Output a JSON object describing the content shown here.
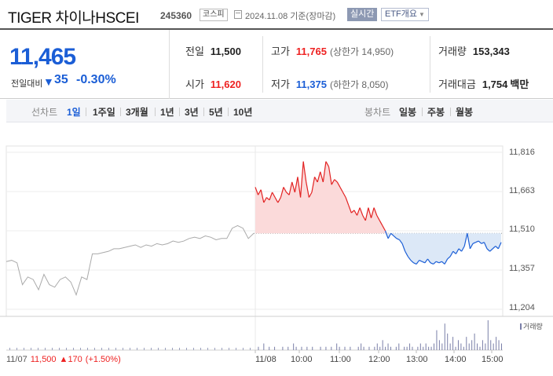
{
  "header": {
    "name": "TIGER 차이나HSCEI",
    "code": "245360",
    "market": "코스피",
    "date_text": "2024.11.08 기준(장마감)",
    "realtime": "실시간",
    "etf_overview": "ETF개요"
  },
  "quote": {
    "price": "11,465",
    "compare_label": "전일대비",
    "change_arrow": "▼",
    "change": "35",
    "change_pct": "-0.30%",
    "prev_label": "전일",
    "prev": "11,500",
    "open_label": "시가",
    "open": "11,620",
    "high_label": "고가",
    "high": "11,765",
    "upper_limit": "(상한가 14,950)",
    "low_label": "저가",
    "low": "11,375",
    "lower_limit": "(하한가 8,050)",
    "volume_label": "거래량",
    "volume": "153,343",
    "amount_label": "거래대금",
    "amount": "1,754",
    "amount_unit": "백만"
  },
  "period_bar": {
    "chart_label": "선차트",
    "periods": [
      "1일",
      "1주일",
      "3개월",
      "1년",
      "3년",
      "5년",
      "10년"
    ],
    "selected": "1일",
    "candle_label": "봉차트",
    "candles": [
      "일봉",
      "주봉",
      "월봉"
    ]
  },
  "colors": {
    "up": "#e22222",
    "down": "#1b5ed6",
    "up_fill": "#fbdada",
    "down_fill": "#dce8f7",
    "prev_line": "#999999"
  },
  "chart_data": {
    "type": "line",
    "ylim": [
      11204,
      11816
    ],
    "yticks": [
      "11,816",
      "11,663",
      "11,510",
      "11,357",
      "11,204"
    ],
    "xticks": [
      "11/07",
      "11/08",
      "10:00",
      "11:00",
      "12:00",
      "13:00",
      "14:00",
      "15:00"
    ],
    "baseline": 11500,
    "series": [
      {
        "values": [
          11390,
          11395,
          11385,
          11300,
          11330,
          11320,
          11280,
          11340,
          11300,
          11290,
          11320,
          11330,
          11310,
          11260,
          11330,
          11320,
          11420,
          11420,
          11425,
          11430,
          11440,
          11440,
          11445,
          11450,
          11455,
          11445,
          11455,
          11450,
          11460,
          11455,
          11460,
          11470,
          11465,
          11470,
          11480,
          11485,
          11480,
          11490,
          11485,
          11475,
          11480,
          11480,
          11520,
          11530,
          11520,
          11480,
          11500
        ]
      },
      {
        "values": [
          11680,
          11650,
          11670,
          11620,
          11640,
          11630,
          11660,
          11640,
          11620,
          11640,
          11680,
          11660,
          11650,
          11700,
          11660,
          11720,
          11640,
          11780,
          11700,
          11640,
          11660,
          11720,
          11700,
          11740,
          11700,
          11780,
          11760,
          11690,
          11710,
          11700,
          11680,
          11660,
          11640,
          11610,
          11580,
          11590,
          11570,
          11600,
          11570,
          11550,
          11600,
          11560,
          11600,
          11570,
          11550,
          11530,
          11510,
          11480,
          11500,
          11490,
          11480,
          11475,
          11460,
          11430,
          11410,
          11395,
          11385,
          11380,
          11395,
          11390,
          11385,
          11400,
          11385,
          11380,
          11390,
          11385,
          11390,
          11380,
          11400,
          11410,
          11430,
          11420,
          11440,
          11430,
          11450,
          11500,
          11440,
          11460,
          11465,
          11470,
          11460,
          11465,
          11440,
          11430,
          11440,
          11450,
          11440,
          11465
        ]
      }
    ],
    "volume": [
      0,
      1,
      0,
      2,
      0,
      1,
      0,
      1,
      0,
      0,
      1,
      0,
      1,
      0,
      2,
      1,
      0,
      1,
      0,
      1,
      0,
      1,
      0,
      0,
      1,
      0,
      1,
      0,
      1,
      0,
      2,
      1,
      0,
      1,
      0,
      1,
      0,
      0,
      1,
      2,
      1,
      0,
      1,
      0,
      1,
      2,
      1,
      3,
      1,
      2,
      1,
      0,
      1,
      2,
      0,
      1,
      1,
      2,
      1,
      0,
      1,
      2,
      1,
      2,
      1,
      1,
      2,
      6,
      3,
      2,
      8,
      5,
      2,
      4,
      1,
      3,
      2,
      1,
      4,
      2,
      3,
      5,
      2,
      1,
      3,
      2,
      9,
      3,
      2,
      4,
      3,
      2
    ],
    "volume_label": "거래량"
  },
  "footer": {
    "date": "11/07",
    "price": "11,500",
    "arrow": "▲",
    "change": "170",
    "pct": "(+1.50%)"
  }
}
